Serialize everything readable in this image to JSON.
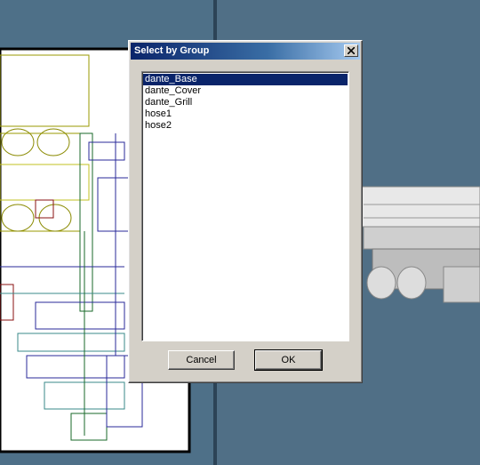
{
  "dialog": {
    "title": "Select by Group",
    "groups": [
      "dante_Base",
      "dante_Cover",
      "dante_Grill",
      "hose1",
      "hose2"
    ],
    "selected_index": 0,
    "cancel_label": "Cancel",
    "ok_label": "OK"
  },
  "colors": {
    "viewport_bg": "#4e7088",
    "dialog_bg": "#d4d0c8",
    "titlebar_start": "#0a246a",
    "titlebar_end": "#a6caf0",
    "selection": "#0a246a"
  },
  "icons": {
    "close": "close-icon"
  }
}
